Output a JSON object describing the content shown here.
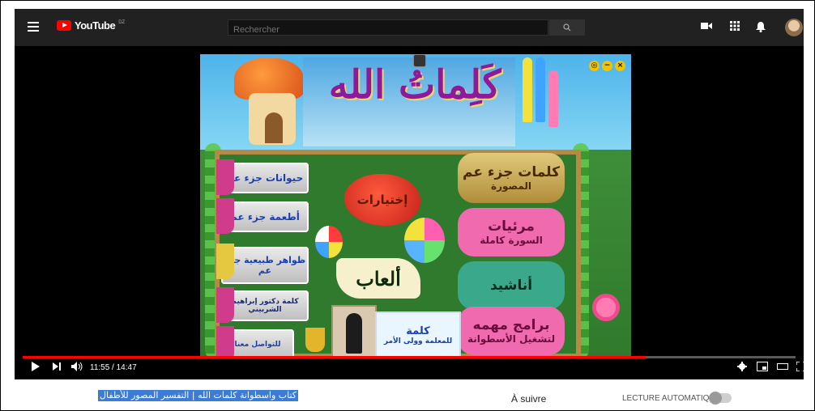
{
  "header": {
    "logo_text": "YouTube",
    "country_code": "DZ",
    "search_placeholder": "Rechercher"
  },
  "video": {
    "app_title": "كَلِماتُ الله",
    "left_buttons": [
      "حيوانات جزء عم",
      "أطعمة جزء عم",
      "ظواهر طبيعية جزء عم",
      "كلمة دكتور إبراهيم الشربيني",
      "للتواصل معنا"
    ],
    "right_buttons": [
      {
        "l1": "كلمات جزء عم",
        "l2": "المصورة"
      },
      {
        "l1": "مرئيات",
        "l2": "السورة كاملة"
      },
      {
        "l1": "أناشيد",
        "l2": ""
      },
      {
        "l1": "برامج مهمه",
        "l2": "لتشغيل الأسطوانة"
      }
    ],
    "options_label": "إختيارات",
    "games_label": "ألعاب",
    "kalima_l1": "كلمة",
    "kalima_l2": "للمعلمة وولى الأمر"
  },
  "controls": {
    "time": "11:55 / 14:47",
    "progress": 0.806
  },
  "below": {
    "video_title": "كتاب واسطوانة كلمات الله | التفسير المصور للأطفال",
    "up_next": "À suivre",
    "autoplay_label": "LECTURE AUTOMATIQUE"
  },
  "colors": {
    "accent": "#ff0000",
    "topbar": "#212121"
  }
}
